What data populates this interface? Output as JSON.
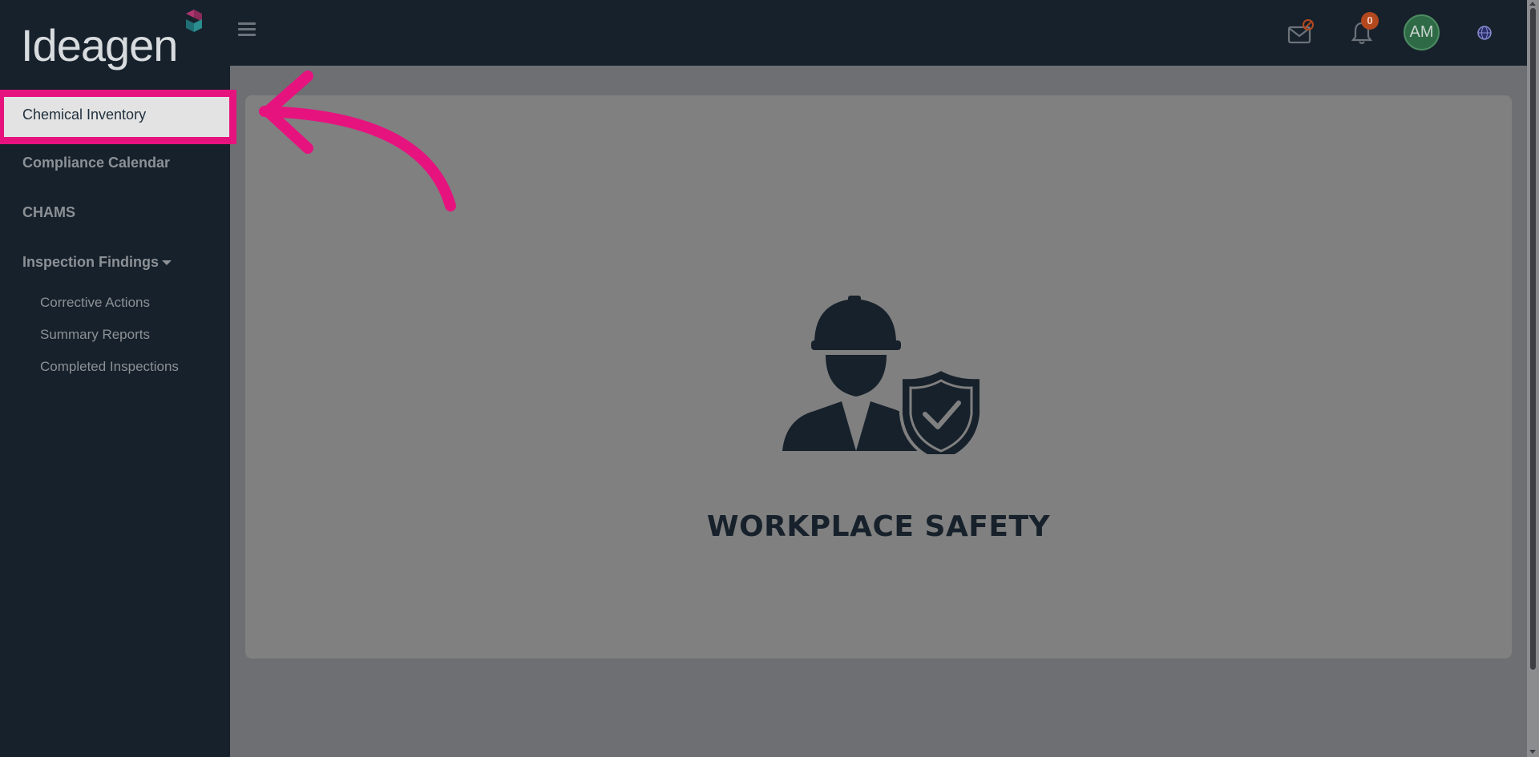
{
  "app": {
    "logo_text": "Ideagen"
  },
  "sidebar": {
    "items": [
      {
        "label": "Chemical Inventory",
        "active": true
      },
      {
        "label": "Compliance Calendar"
      },
      {
        "label": "CHAMS"
      },
      {
        "label": "Inspection Findings",
        "has_dropdown": true
      }
    ],
    "subitems": [
      {
        "label": "Corrective Actions"
      },
      {
        "label": "Summary Reports"
      },
      {
        "label": "Completed Inspections"
      }
    ]
  },
  "header": {
    "menu_icon": "hamburger-icon",
    "messages_icon": "mail-blocked-icon",
    "notifications_icon": "bell-icon",
    "notifications_count": "0",
    "user_initials": "AM",
    "extra_icon": "globe-badge-icon"
  },
  "main": {
    "hero_title": "WORKPLACE SAFETY",
    "hero_icon": "worker-shield-icon"
  },
  "annotation": {
    "highlight_color": "#e6137f"
  }
}
